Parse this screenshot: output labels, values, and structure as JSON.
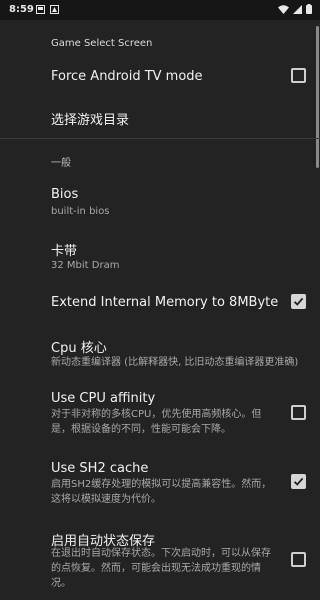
{
  "status_bar": {
    "time": "8:59",
    "left_icons": [
      "notification-icon",
      "notification-icon"
    ],
    "right_icons": [
      "wifi-icon",
      "signal-icon",
      "battery-icon"
    ]
  },
  "game_select_header": "Game Select Screen",
  "force_tv": {
    "title": "Force Android TV mode",
    "checked": false
  },
  "select_dir": {
    "title": "选择游戏目录"
  },
  "general_header": "一般",
  "bios": {
    "title": "Bios",
    "subtitle": "built-in bios"
  },
  "cartridge": {
    "title": "卡带",
    "subtitle": "32 Mbit Dram"
  },
  "extend_mem": {
    "title": "Extend Internal Memory to 8MByte",
    "checked": true
  },
  "cpu_core": {
    "title": "Cpu 核心",
    "subtitle": "新动态重编译器 (比解释器快, 比旧动态重编译器更准确)"
  },
  "cpu_affinity": {
    "title": "Use CPU affinity",
    "subtitle": "对于非对称的多核CPU，优先使用高频核心。但是，根据设备的不同，性能可能会下降。",
    "checked": false
  },
  "sh2_cache": {
    "title": "Use SH2 cache",
    "subtitle": "启用SH2缓存处理的模拟可以提高兼容性。然而，这将以模拟速度为代价。",
    "checked": true
  },
  "auto_save": {
    "title": "启用自动状态保存",
    "subtitle": "在退出时自动保存状态。下次启动时，可以从保存的点恢复。然而，可能会出现无法成功重现的情况。",
    "checked": false
  },
  "colors": {
    "background": "#232323",
    "status_bar": "#161616",
    "checkbox": "#d6d6d6"
  }
}
